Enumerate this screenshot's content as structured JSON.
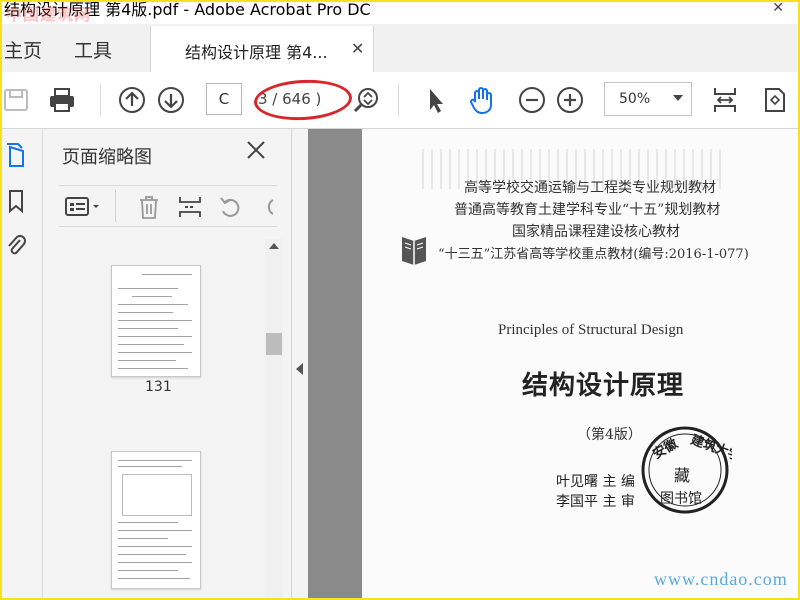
{
  "window": {
    "title": "结构设计原理 第4版.pdf - Adobe Acrobat Pro DC",
    "watermark": "中国建筑网",
    "close_glyph": "✕"
  },
  "tabs": {
    "home": "主页",
    "tools": "工具",
    "document": "结构设计原理  第4...",
    "document_close": "✕"
  },
  "toolbar": {
    "page_input": "C",
    "page_count": "3 / 646 )",
    "zoom": "50%"
  },
  "panel": {
    "title": "页面缩略图",
    "thumbnail_page": "131"
  },
  "document": {
    "series_line1": "高等学校交通运输与工程类专业规划教材",
    "series_line2": "普通高等教育土建学科专业“十五”规划教材",
    "series_line3": "国家精品课程建设核心教材",
    "series_line4": "“十三五”江苏省高等学校重点教材(编号:2016-1-077)",
    "english_title": "Principles of Structural Design",
    "title": "结构设计原理",
    "edition": "（第4版）",
    "author1": "叶见曙  主  编",
    "author2": "李国平  主  审",
    "watermark": "www.cndao.com",
    "stamp_text": "安徽建筑大学 图书馆"
  },
  "colors": {
    "accent_red": "#d8262a",
    "hand_tool_blue": "#1473e6",
    "frame_yellow": "#f5e21b"
  }
}
